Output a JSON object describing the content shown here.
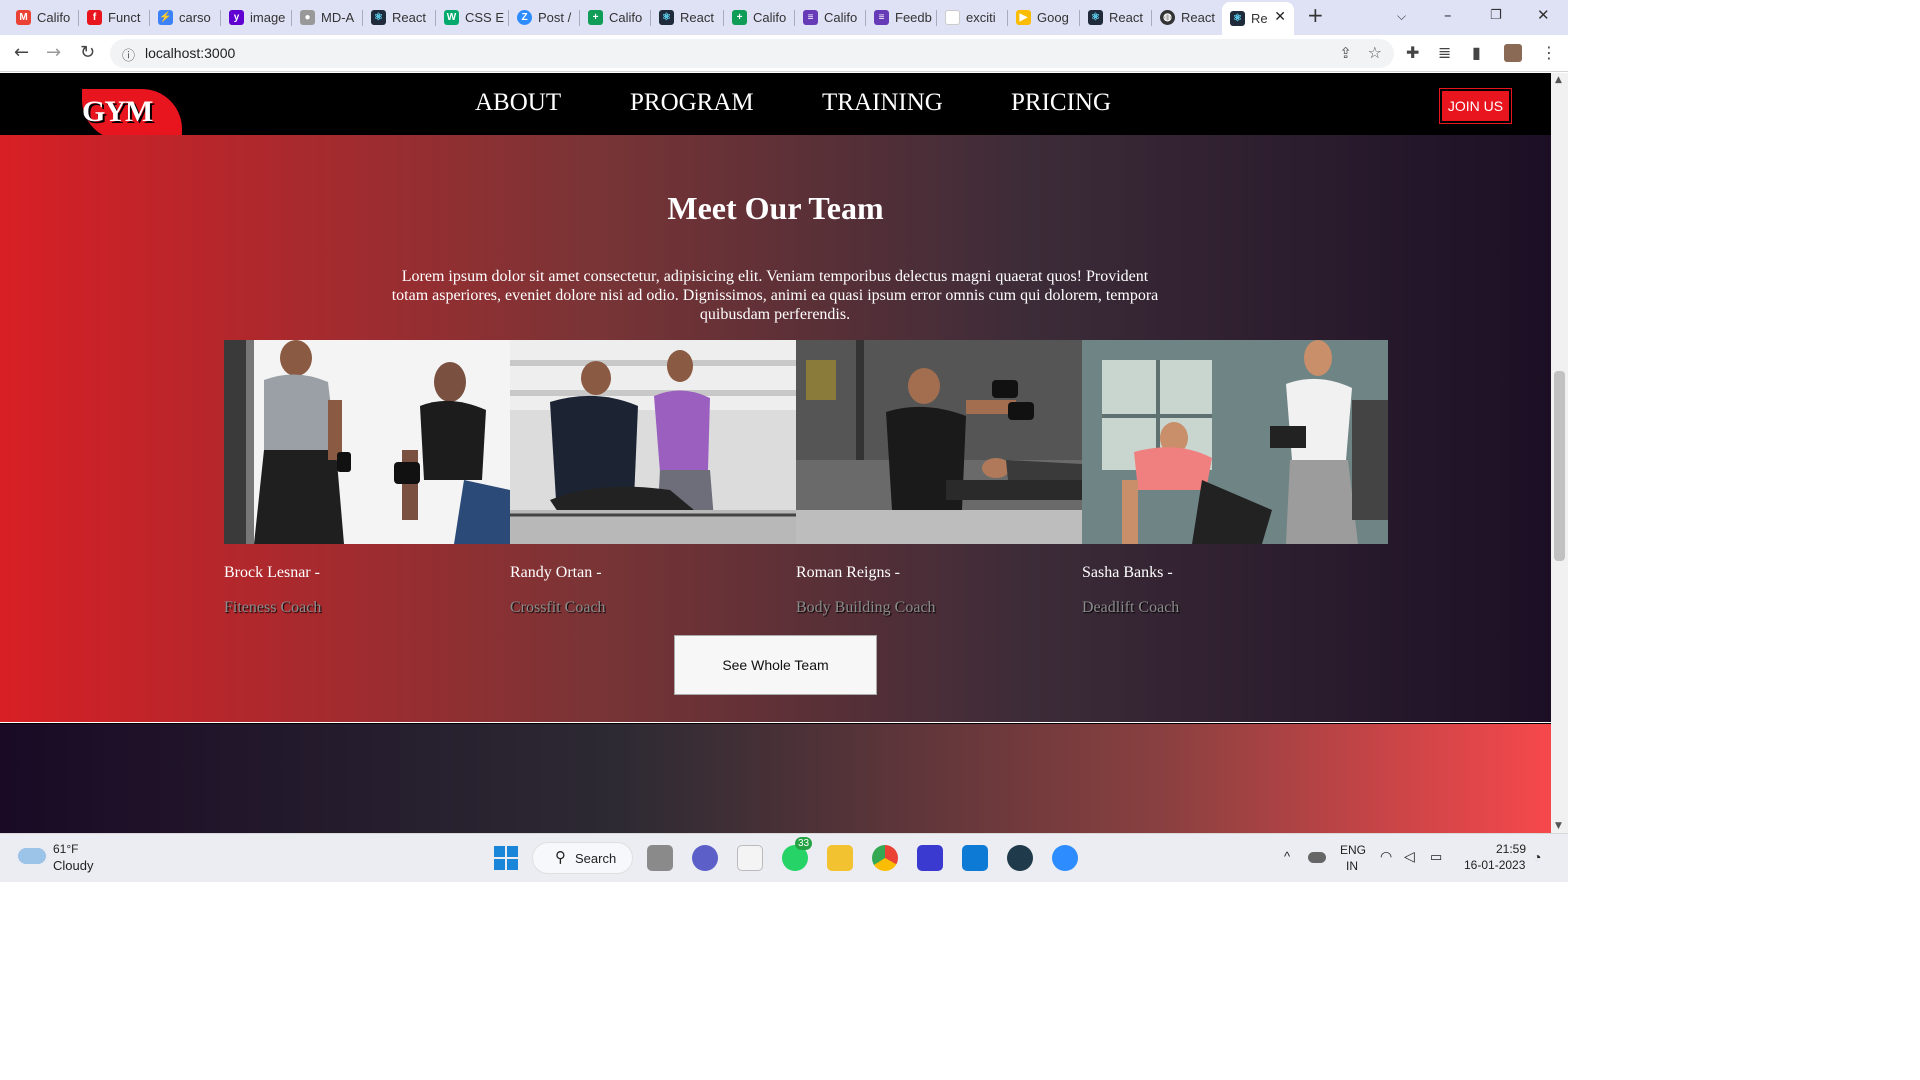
{
  "browser": {
    "tabs": [
      {
        "label": "Califo",
        "icon": "gmail-icon",
        "color": "#ea4335"
      },
      {
        "label": "Funct",
        "icon": "function-icon",
        "color": "#e8141e"
      },
      {
        "label": "carso",
        "icon": "bolt-icon",
        "color": "#3b82f6"
      },
      {
        "label": "image",
        "icon": "yahoo-icon",
        "color": "#6001d2"
      },
      {
        "label": "MD-A",
        "icon": "github-icon",
        "color": "#999999"
      },
      {
        "label": "React",
        "icon": "react-icon",
        "color": "#1f2b3a"
      },
      {
        "label": "CSS E",
        "icon": "w3-icon",
        "color": "#04aa6d"
      },
      {
        "label": "Post /",
        "icon": "zoom-z-icon",
        "color": "#2d8cff"
      },
      {
        "label": "Califo",
        "icon": "plus-sheet-icon",
        "color": "#0f9d58"
      },
      {
        "label": "React",
        "icon": "react-icon",
        "color": "#1f2b3a"
      },
      {
        "label": "Califo",
        "icon": "plus-sheet-icon",
        "color": "#0f9d58"
      },
      {
        "label": "Califo",
        "icon": "form-icon",
        "color": "#673ab7"
      },
      {
        "label": "Feedb",
        "icon": "form-icon",
        "color": "#673ab7"
      },
      {
        "label": "exciti",
        "icon": "blank-page-icon",
        "color": "#dddddd"
      },
      {
        "label": "Goog",
        "icon": "meet-icon",
        "color": "#fbbc04"
      },
      {
        "label": "React",
        "icon": "react-icon",
        "color": "#1f2b3a"
      },
      {
        "label": "React",
        "icon": "globe-icon",
        "color": "#333333"
      },
      {
        "label": "Re",
        "icon": "react-icon",
        "color": "#1f2b3a"
      }
    ],
    "url": "localhost:3000"
  },
  "site": {
    "logo": "GYM",
    "nav": [
      "ABOUT",
      "PROGRAM",
      "TRAINING",
      "PRICING"
    ],
    "join_label": "JOIN US",
    "accent": "#e8141e"
  },
  "team": {
    "title": "Meet Our Team",
    "description": "Lorem ipsum dolor sit amet consectetur, adipisicing elit. Veniam temporibus delectus magni quaerat quos! Provident totam asperiores, eveniet dolore nisi ad odio. Dignissimos, animi ea quasi ipsum error omnis cum qui dolorem, tempora quibusdam perferendis.",
    "members": [
      {
        "name": "Brock Lesnar -",
        "role": "Fiteness Coach"
      },
      {
        "name": "Randy Ortan -",
        "role": "Crossfit Coach"
      },
      {
        "name": "Roman Reigns -",
        "role": "Body Building Coach"
      },
      {
        "name": "Sasha Banks -",
        "role": "Deadlift Coach"
      }
    ],
    "button_label": "See Whole Team"
  },
  "taskbar": {
    "weather_temp": "61°F",
    "weather_desc": "Cloudy",
    "search_label": "Search",
    "whatsapp_badge": "33",
    "lang_line1": "ENG",
    "lang_line2": "IN",
    "time": "21:59",
    "date": "16-01-2023"
  }
}
